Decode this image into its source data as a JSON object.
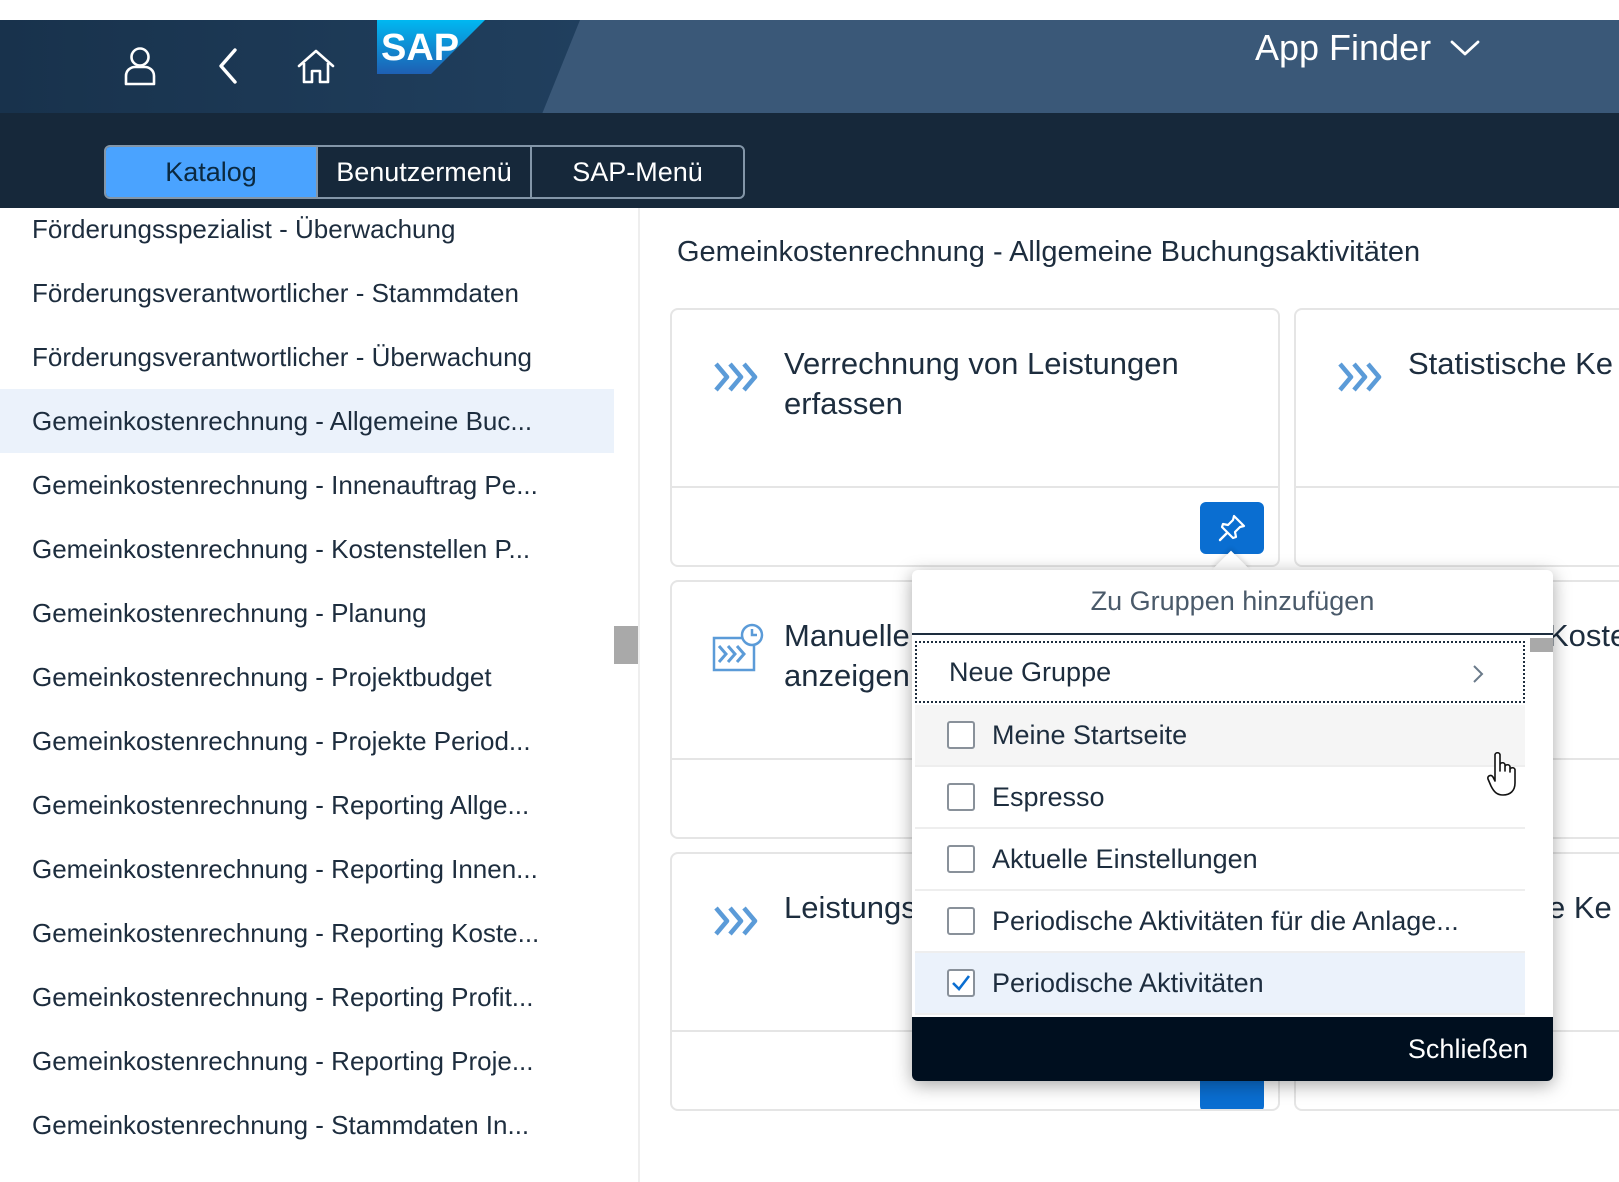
{
  "header": {
    "app_title": "App Finder",
    "icons": [
      "user-icon",
      "back-icon",
      "home-icon",
      "sap-logo",
      "chevron-down-icon"
    ],
    "logo_text": "SAP"
  },
  "tabs": [
    {
      "label": "Katalog",
      "active": true
    },
    {
      "label": "Benutzermenü",
      "active": false
    },
    {
      "label": "SAP-Menü",
      "active": false
    }
  ],
  "catalog_list": [
    {
      "label": "Förderungsspezialist - Überwachung"
    },
    {
      "label": "Förderungsverantwortlicher - Stammdaten"
    },
    {
      "label": "Förderungsverantwortlicher - Überwachung"
    },
    {
      "label": "Gemeinkostenrechnung - Allgemeine Buc...",
      "selected": true
    },
    {
      "label": "Gemeinkostenrechnung - Innenauftrag Pe..."
    },
    {
      "label": "Gemeinkostenrechnung - Kostenstellen P..."
    },
    {
      "label": "Gemeinkostenrechnung - Planung"
    },
    {
      "label": "Gemeinkostenrechnung - Projektbudget"
    },
    {
      "label": "Gemeinkostenrechnung - Projekte Period..."
    },
    {
      "label": "Gemeinkostenrechnung - Reporting Allge..."
    },
    {
      "label": "Gemeinkostenrechnung - Reporting Innen..."
    },
    {
      "label": "Gemeinkostenrechnung - Reporting Koste..."
    },
    {
      "label": "Gemeinkostenrechnung - Reporting Profit..."
    },
    {
      "label": "Gemeinkostenrechnung - Reporting Proje..."
    },
    {
      "label": "Gemeinkostenrechnung - Stammdaten In..."
    }
  ],
  "main": {
    "catalog_title": "Gemeinkostenrechnung - Allgemeine Buchungsaktivitäten",
    "tiles": [
      {
        "line1": "Verrechnung von Leistungen",
        "line2": "erfassen",
        "icon": "chevrons-icon"
      },
      {
        "line1": "Statistische Ke",
        "line2": "",
        "icon": "chevrons-icon"
      },
      {
        "line1": "Manuelle",
        "line2": "anzeigen",
        "icon": "chevrons-clock-icon"
      },
      {
        "line1": "Koste",
        "line2": "",
        "icon": ""
      },
      {
        "line1": "Leistungs",
        "line2": "",
        "icon": "chevrons-icon"
      },
      {
        "line1": "e Ke",
        "line2": "",
        "icon": ""
      }
    ]
  },
  "popover": {
    "title": "Zu Gruppen hinzufügen",
    "new_group": "Neue Gruppe",
    "groups": [
      {
        "label": "Meine Startseite",
        "checked": false
      },
      {
        "label": "Espresso",
        "checked": false
      },
      {
        "label": "Aktuelle Einstellungen",
        "checked": false
      },
      {
        "label": "Periodische Aktivitäten für die Anlage...",
        "checked": false
      },
      {
        "label": "Periodische Aktivitäten",
        "checked": true
      }
    ],
    "close_label": "Schließen"
  },
  "colors": {
    "shell_bg": "#1d3b58",
    "subheader_bg": "#16283a",
    "active_tab": "#4aa3ff",
    "accent_blue": "#0a6ed1",
    "selected_row": "#ebf2fb",
    "footer_bg": "#000f1f"
  }
}
